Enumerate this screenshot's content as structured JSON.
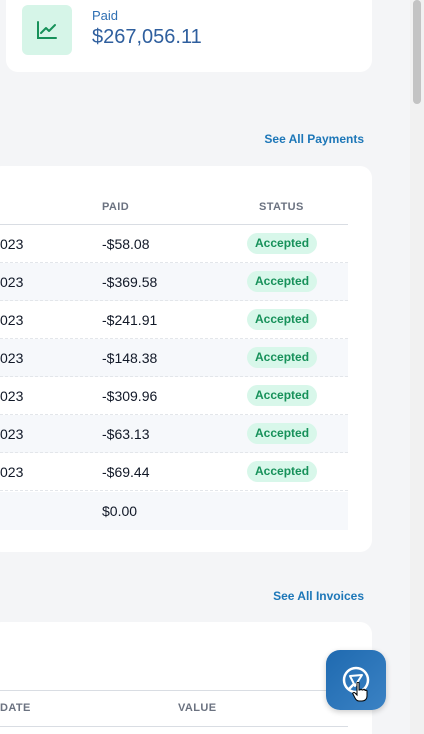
{
  "summary": {
    "label": "Paid",
    "value": "$267,056.11",
    "icon": "chart-line-icon",
    "accent": "#17915a"
  },
  "payments": {
    "see_all": "See All Payments",
    "columns": {
      "paid": "PAID",
      "status": "STATUS"
    },
    "rows": [
      {
        "date": "023",
        "paid": "-$58.08",
        "status": "Accepted"
      },
      {
        "date": "023",
        "paid": "-$369.58",
        "status": "Accepted"
      },
      {
        "date": "023",
        "paid": "-$241.91",
        "status": "Accepted"
      },
      {
        "date": "023",
        "paid": "-$148.38",
        "status": "Accepted"
      },
      {
        "date": "023",
        "paid": "-$309.96",
        "status": "Accepted"
      },
      {
        "date": "023",
        "paid": "-$63.13",
        "status": "Accepted"
      },
      {
        "date": "023",
        "paid": "-$69.44",
        "status": "Accepted"
      }
    ],
    "total": "$0.00"
  },
  "invoices": {
    "see_all": "See All Invoices",
    "columns": {
      "date": "DATE",
      "value": "VALUE"
    }
  },
  "chat": {
    "icon": "chat-send-icon",
    "color": "#1f6ab0"
  }
}
